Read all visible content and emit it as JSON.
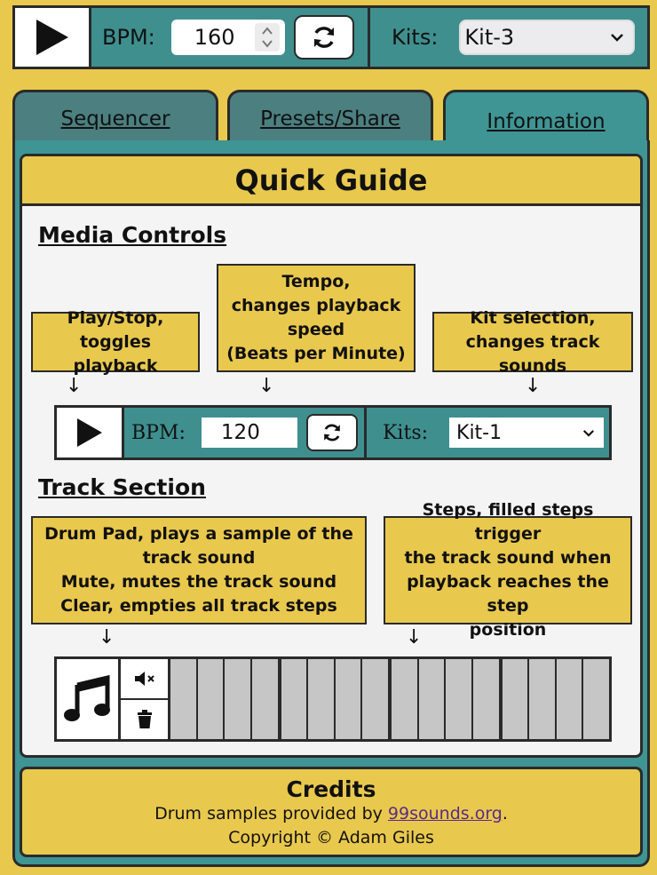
{
  "controls": {
    "bpm_label": "BPM:",
    "bpm_value": "160",
    "kits_label": "Kits:",
    "kit_selected": "Kit-3"
  },
  "tabs": [
    {
      "label": "Sequencer"
    },
    {
      "label": "Presets/Share"
    },
    {
      "label": "Information"
    }
  ],
  "guide": {
    "title": "Quick Guide",
    "media_heading": "Media Controls",
    "callout_play": [
      "Play/Stop,",
      "toggles playback"
    ],
    "callout_tempo": [
      "Tempo,",
      "changes playback",
      "speed",
      "(Beats per Minute)"
    ],
    "callout_kit": [
      "Kit selection,",
      "changes track sounds"
    ],
    "example_bpm_label": "BPM:",
    "example_bpm_value": "120",
    "example_kits_label": "Kits:",
    "example_kit_selected": "Kit-1",
    "track_heading": "Track Section",
    "callout_track": [
      "Drum Pad, plays a sample of the",
      "track sound",
      "Mute, mutes the track sound",
      "Clear, empties all track steps"
    ],
    "callout_steps": [
      "Steps, filled steps trigger",
      "the track sound when",
      "playback reaches the step",
      "position"
    ],
    "arrow": "↓",
    "step_count": 16
  },
  "credits": {
    "title": "Credits",
    "line1_prefix": "Drum samples provided by ",
    "line1_link": "99sounds.org",
    "line1_suffix": ".",
    "line2": "Copyright © Adam Giles"
  },
  "colors": {
    "background": "#e9c84e",
    "teal": "#3f9494",
    "tab_inactive": "#4b7f80",
    "step_empty": "#c6c6c6",
    "link": "#5b2a86"
  },
  "icons": [
    "play-icon",
    "spinner-icon",
    "reload-icon",
    "chevron-down-icon",
    "music-note-icon",
    "mute-icon",
    "trash-icon"
  ]
}
